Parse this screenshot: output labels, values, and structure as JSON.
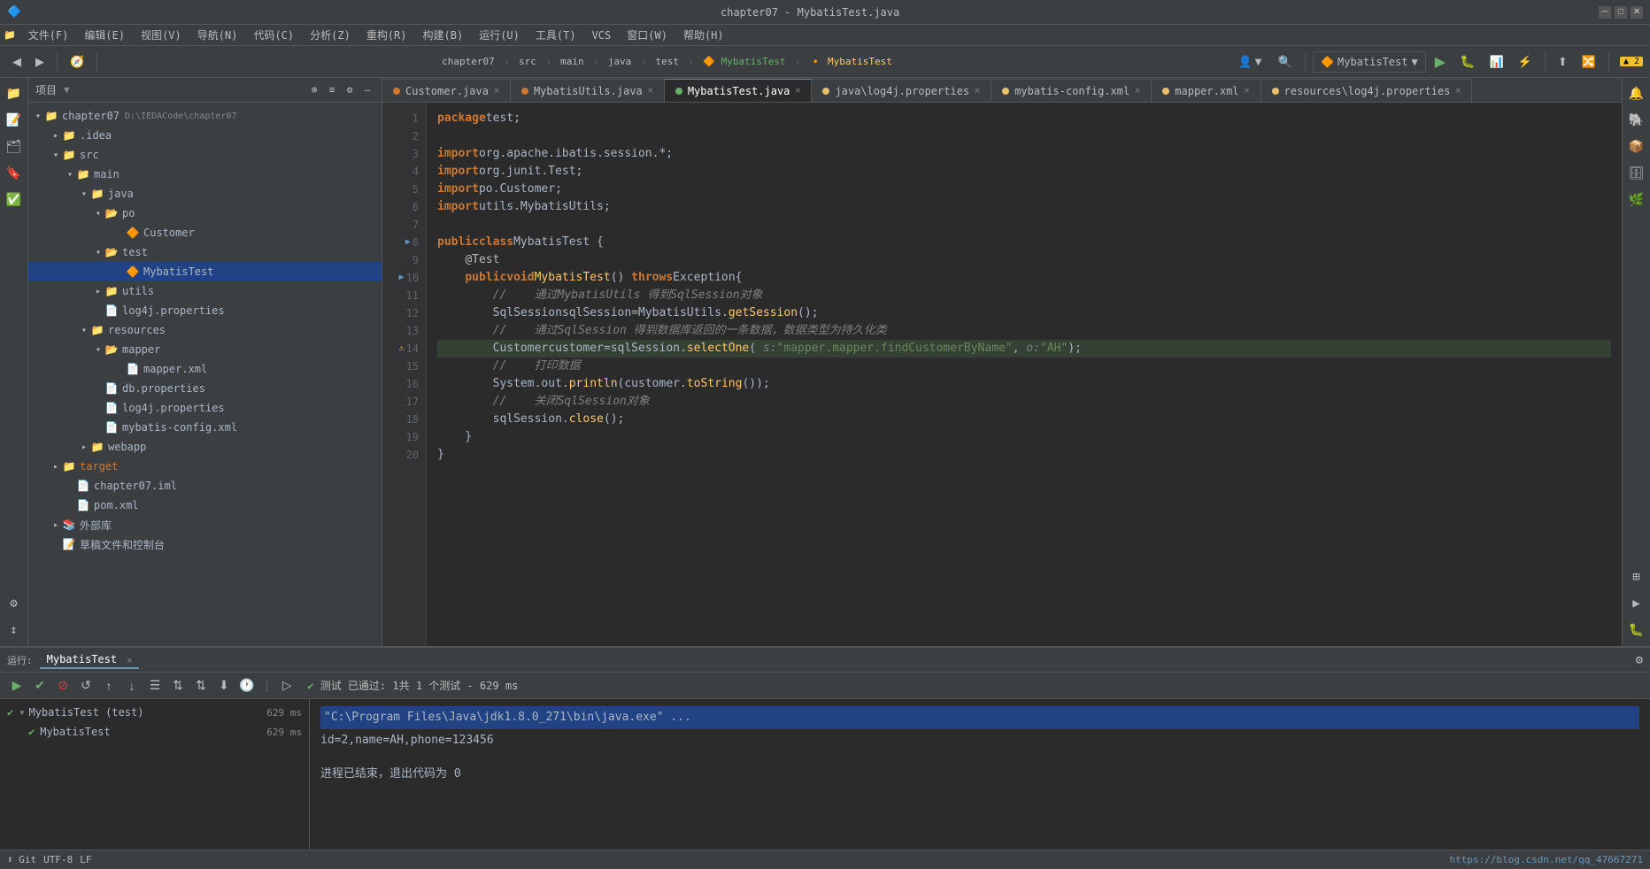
{
  "titleBar": {
    "title": "chapter07 - MybatisTest.java",
    "windowControls": [
      "minimize",
      "maximize",
      "close"
    ]
  },
  "menuBar": {
    "items": [
      "文件(F)",
      "编辑(E)",
      "视图(V)",
      "导航(N)",
      "代码(C)",
      "分析(Z)",
      "重构(R)",
      "构建(B)",
      "运行(U)",
      "工具(T)",
      "VCS",
      "窗口(W)",
      "帮助(H)"
    ]
  },
  "navBar": {
    "breadcrumbs": [
      "chapter07",
      "src",
      "main",
      "java",
      "test",
      "MybatisTest",
      "MybatisTest"
    ]
  },
  "sidebar": {
    "title": "项目",
    "tree": [
      {
        "id": "chapter07",
        "label": "chapter07",
        "type": "project",
        "depth": 0,
        "expanded": true,
        "path": "D:\\IEDACode\\chapter07"
      },
      {
        "id": "idea",
        "label": ".idea",
        "type": "folder",
        "depth": 1,
        "expanded": false
      },
      {
        "id": "src",
        "label": "src",
        "type": "folder",
        "depth": 1,
        "expanded": true
      },
      {
        "id": "main",
        "label": "main",
        "type": "folder",
        "depth": 2,
        "expanded": true
      },
      {
        "id": "java",
        "label": "java",
        "type": "folder",
        "depth": 3,
        "expanded": true
      },
      {
        "id": "po",
        "label": "po",
        "type": "folder",
        "depth": 4,
        "expanded": true
      },
      {
        "id": "Customer",
        "label": "Customer",
        "type": "class-orange",
        "depth": 5
      },
      {
        "id": "test",
        "label": "test",
        "type": "folder",
        "depth": 3,
        "expanded": true
      },
      {
        "id": "MybatisTest",
        "label": "MybatisTest",
        "type": "class-green",
        "depth": 4,
        "selected": true
      },
      {
        "id": "utils",
        "label": "utils",
        "type": "folder",
        "depth": 3,
        "expanded": false
      },
      {
        "id": "log4j.properties1",
        "label": "log4j.properties",
        "type": "file-xml",
        "depth": 3
      },
      {
        "id": "resources",
        "label": "resources",
        "type": "folder",
        "depth": 2,
        "expanded": true
      },
      {
        "id": "mapper",
        "label": "mapper",
        "type": "folder",
        "depth": 3,
        "expanded": true
      },
      {
        "id": "mapper.xml",
        "label": "mapper.xml",
        "type": "file-xml",
        "depth": 4
      },
      {
        "id": "db.properties",
        "label": "db.properties",
        "type": "file-props",
        "depth": 3
      },
      {
        "id": "log4j.properties2",
        "label": "log4j.properties",
        "type": "file-xml",
        "depth": 3
      },
      {
        "id": "mybatis-config.xml",
        "label": "mybatis-config.xml",
        "type": "file-xml",
        "depth": 3
      },
      {
        "id": "webapp",
        "label": "webapp",
        "type": "folder",
        "depth": 2,
        "expanded": false
      },
      {
        "id": "target",
        "label": "target",
        "type": "folder",
        "depth": 1,
        "expanded": false
      },
      {
        "id": "chapter07.iml",
        "label": "chapter07.iml",
        "type": "file-iml",
        "depth": 1
      },
      {
        "id": "pom.xml",
        "label": "pom.xml",
        "type": "file-xml",
        "depth": 1
      }
    ],
    "externalLibs": "外部库",
    "scratchFiles": "草稿文件和控制台"
  },
  "tabs": [
    {
      "id": "customer-java",
      "label": "Customer.java",
      "type": "orange",
      "active": false,
      "modified": false
    },
    {
      "id": "mybatisutils-java",
      "label": "MybatisUtils.java",
      "type": "orange",
      "active": false,
      "modified": false
    },
    {
      "id": "mybatistest-java",
      "label": "MybatisTest.java",
      "type": "green",
      "active": true,
      "modified": false
    },
    {
      "id": "log4j-java",
      "label": "java\\log4j.properties",
      "type": "xml",
      "active": false,
      "modified": false
    },
    {
      "id": "mybatis-config",
      "label": "mybatis-config.xml",
      "type": "xml",
      "active": false,
      "modified": false
    },
    {
      "id": "mapper-xml",
      "label": "mapper.xml",
      "type": "xml",
      "active": false,
      "modified": false
    },
    {
      "id": "resources-log4j",
      "label": "resources\\log4j.properties",
      "type": "xml",
      "active": false,
      "modified": false
    }
  ],
  "warningBadge": "▲ 2",
  "codeLines": [
    {
      "num": 1,
      "gutter": "",
      "content": "package test;"
    },
    {
      "num": 2,
      "gutter": "",
      "content": ""
    },
    {
      "num": 3,
      "gutter": "",
      "content": "import org.apache.ibatis.session.*;"
    },
    {
      "num": 4,
      "gutter": "",
      "content": "import org.junit.Test;"
    },
    {
      "num": 5,
      "gutter": "",
      "content": "import po.Customer;"
    },
    {
      "num": 6,
      "gutter": "",
      "content": "import utils.MybatisUtils;"
    },
    {
      "num": 7,
      "gutter": "",
      "content": ""
    },
    {
      "num": 8,
      "gutter": "run",
      "content": "public class MybatisTest {"
    },
    {
      "num": 9,
      "gutter": "",
      "content": "    @Test"
    },
    {
      "num": 10,
      "gutter": "run2",
      "content": "    public void MybatisTest() throws Exception{"
    },
    {
      "num": 11,
      "gutter": "",
      "content": "        //    通过MybatisUtils 得到SqlSession对象"
    },
    {
      "num": 12,
      "gutter": "",
      "content": "        SqlSession sqlSession=MybatisUtils.getSession();"
    },
    {
      "num": 13,
      "gutter": "",
      "content": "        //    通过SqlSession 得到数据库返回的一条数据，数据类型为持久化类"
    },
    {
      "num": 14,
      "gutter": "warn",
      "content": "        Customer customer=sqlSession.selectOne( s: \"mapper.mapper.findCustomerByName\", o: \"AH\");"
    },
    {
      "num": 15,
      "gutter": "",
      "content": "        //    打印数据"
    },
    {
      "num": 16,
      "gutter": "",
      "content": "        System.out.println(customer.toString());"
    },
    {
      "num": 17,
      "gutter": "",
      "content": "        //    关闭SqlSession对象"
    },
    {
      "num": 18,
      "gutter": "",
      "content": "        sqlSession.close();"
    },
    {
      "num": 19,
      "gutter": "collapse",
      "content": "    }"
    },
    {
      "num": 20,
      "gutter": "",
      "content": "}"
    }
  ],
  "bottomPanel": {
    "tabs": [
      {
        "id": "run",
        "label": "运行:",
        "active": true
      },
      {
        "id": "mybatistest",
        "label": "MybatisTest",
        "active": true
      }
    ],
    "runStatus": "测试 已通过: 1共 1 个测试 - 629 ms",
    "testTree": [
      {
        "id": "mybatistest-suite",
        "label": "MybatisTest (test)",
        "time": "629 ms",
        "depth": 0,
        "pass": true,
        "expanded": true
      },
      {
        "id": "mybatistest-method",
        "label": "MybatisTest",
        "time": "629 ms",
        "depth": 1,
        "pass": true
      }
    ],
    "output": [
      {
        "type": "cmd",
        "text": "\"C:\\Program Files\\Java\\jdk1.8.0_271\\bin\\java.exe\" ..."
      },
      {
        "type": "normal",
        "text": "id=2,name=AH,phone=123456"
      },
      {
        "type": "process",
        "text": "进程已结束，退出代码为 0"
      }
    ]
  },
  "statusBar": {
    "rightItems": [
      "https://blog.csdn.net/qq_47667271"
    ]
  },
  "toolbar": {
    "runConfig": "MybatisTest",
    "vcsIcon": "↑"
  }
}
